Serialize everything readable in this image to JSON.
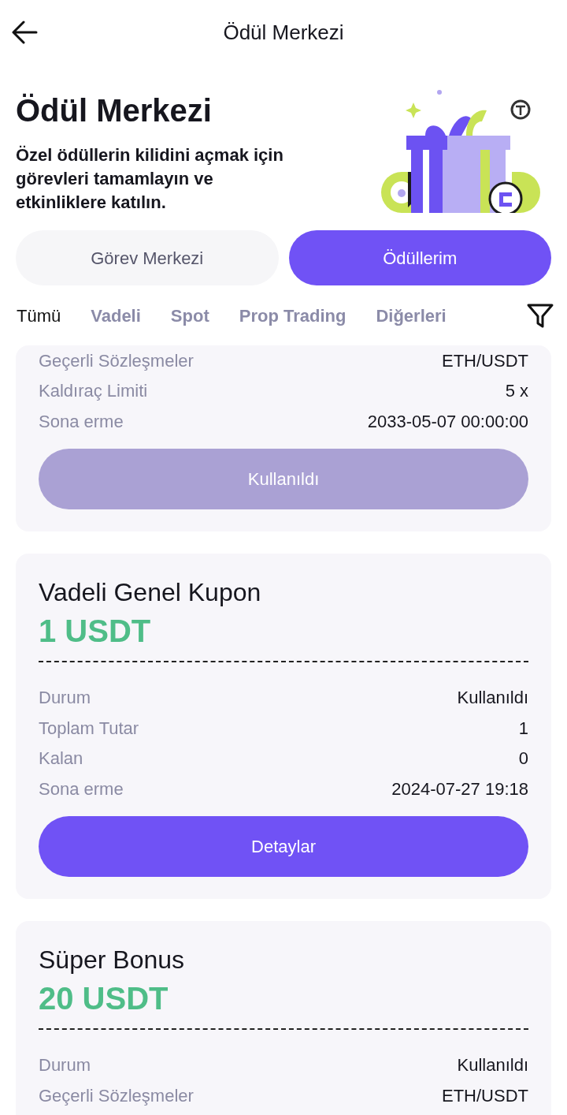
{
  "header": {
    "title": "Ödül Merkezi"
  },
  "hero": {
    "title": "Ödül Merkezi",
    "description": "Özel ödüllerin kilidini açmak için görevleri tamamlayın ve etkinliklere katılın."
  },
  "segments": [
    {
      "label": "Görev Merkezi",
      "selected": false
    },
    {
      "label": "Ödüllerim",
      "selected": true
    }
  ],
  "tabs": [
    {
      "label": "Tümü",
      "selected": true
    },
    {
      "label": "Vadeli",
      "selected": false
    },
    {
      "label": "Spot",
      "selected": false
    },
    {
      "label": "Prop Trading",
      "selected": false
    },
    {
      "label": "Diğerleri",
      "selected": false
    }
  ],
  "rewards": [
    {
      "rows": [
        {
          "label": "Geçerli Sözleşmeler",
          "value": "ETH/USDT"
        },
        {
          "label": "Kaldıraç Limiti",
          "value": "5 x"
        },
        {
          "label": "Sona erme",
          "value": "2033-05-07 00:00:00"
        }
      ],
      "button": {
        "label": "Kullanıldı",
        "disabled": true
      }
    },
    {
      "title": "Vadeli Genel Kupon",
      "amount": "1 USDT",
      "rows": [
        {
          "label": "Durum",
          "value": "Kullanıldı"
        },
        {
          "label": "Toplam Tutar",
          "value": "1"
        },
        {
          "label": "Kalan",
          "value": "0"
        },
        {
          "label": "Sona erme",
          "value": "2024-07-27 19:18"
        }
      ],
      "button": {
        "label": "Detaylar",
        "disabled": false
      }
    },
    {
      "title": "Süper Bonus",
      "amount": "20 USDT",
      "rows": [
        {
          "label": "Durum",
          "value": "Kullanıldı"
        },
        {
          "label": "Geçerli Sözleşmeler",
          "value": "ETH/USDT"
        }
      ]
    }
  ]
}
